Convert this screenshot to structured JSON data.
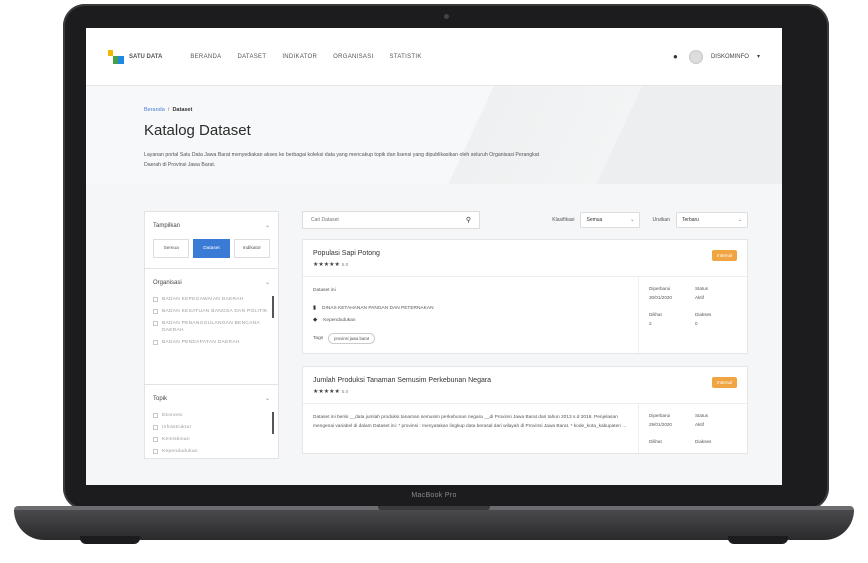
{
  "device": {
    "label": "MacBook Pro"
  },
  "nav": {
    "logo_text": "SATU DATA",
    "menu": [
      "BERANDA",
      "DATASET",
      "INDIKATOR",
      "ORGANISASI",
      "STATISTIK"
    ],
    "user": "DISKOMINFO",
    "brand_colors": {
      "yellow": "#f2b705",
      "green": "#43a047",
      "blue": "#1e88e5"
    }
  },
  "breadcrumb": {
    "home": "Beranda",
    "separator": "/",
    "current": "Dataset"
  },
  "page": {
    "title": "Katalog Dataset",
    "description": "Layanan portal Satu Data Jawa Barat menyediakan akses ke berbagai koleksi data yang mencakup topik dan lisensi yang dipublikasikan oleh seluruh Organisasi Perangkat Daerah di Provinsi Jawa Barat."
  },
  "sidebar": {
    "display": {
      "label": "Tampilkan",
      "options": [
        "Semua",
        "Dataset",
        "Indikator"
      ],
      "active": "Dataset"
    },
    "organisasi": {
      "label": "Organisasi",
      "items": [
        "BADAN KEPEGAWAIAN DAERAH",
        "BADAN KESATUAN BANGSA DAN POLITIK",
        "BADAN PENANGGULANGAN BENCANA DAERAH",
        "BADAN PENDAPATAN DAERAH"
      ]
    },
    "topik": {
      "label": "Topik",
      "items": [
        "Ekonomi",
        "Infrastruktur",
        "Kemiskinan",
        "Kependudukan"
      ]
    }
  },
  "toolbar": {
    "search_placeholder": "Cari Dataset",
    "klasifikasi_label": "Klasifikasi",
    "klasifikasi_value": "Semua",
    "urutkan_label": "Urutkan",
    "urutkan_value": "Terbaru"
  },
  "datasets": [
    {
      "title": "Populasi Sapi Potong",
      "rating": "5.0",
      "badge": "Internal",
      "desc": "Dataset ini",
      "org": "DINAS KETAHANAN PANGAN DAN PETERNAKAN",
      "topic": "Kependudukan",
      "tags_label": "Tags",
      "tag": "provinsi jawa barat",
      "updated_label": "Diperbarui",
      "updated": "30/01/2020",
      "status_label": "Status",
      "status": "Aktif",
      "views_label": "Dilihat",
      "views": "2",
      "downloads_label": "Diakses",
      "downloads": "0"
    },
    {
      "title": "Jumlah Produksi Tanaman Semusim Perkebunan Negara",
      "rating": "5.0",
      "badge": "Internal",
      "desc": "Dataset ini berisi __data jumlah produksi tanaman semusim perkebunan negara __di Provinsi Jawa Barat dari tahun 2013 s.d 2018. Penjelasan mengenai variabel di dalam Dataset ini: * provinsi : menyatakan lingkup data berasal dari wilayah di Provinsi Jawa Barat. * kode_kota_kabupaten ...",
      "updated_label": "Diperbarui",
      "updated": "29/01/2020",
      "status_label": "Status",
      "status": "Aktif",
      "views_label": "Dilihat",
      "downloads_label": "Diakses"
    }
  ]
}
